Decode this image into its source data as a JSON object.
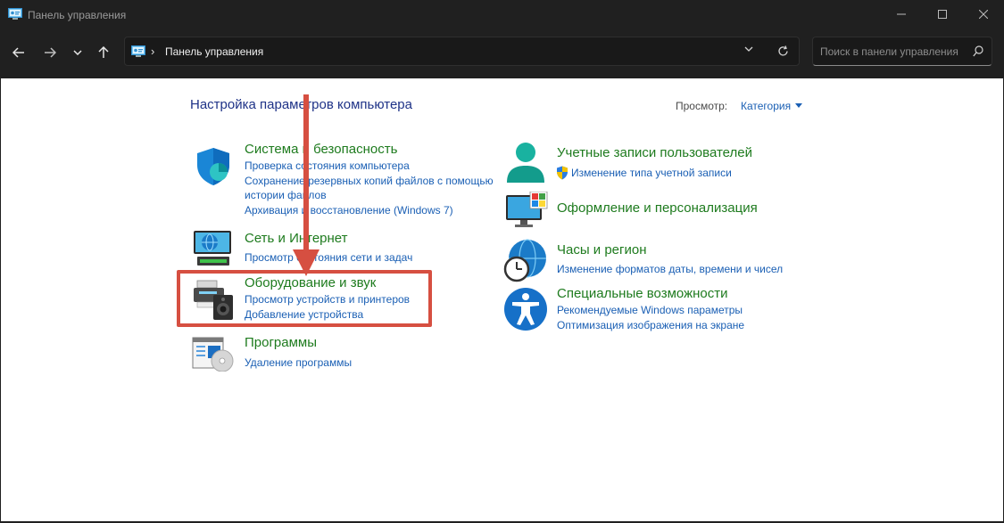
{
  "window": {
    "title": "Панель управления",
    "controls": [
      "minimize",
      "maximize",
      "close"
    ]
  },
  "nav": {
    "back_icon": "back-arrow-icon",
    "forward_icon": "forward-arrow-icon",
    "recent_icon": "chevron-down-icon",
    "up_icon": "up-arrow-icon"
  },
  "address": {
    "path": "Панель управления",
    "separator": "›"
  },
  "search": {
    "placeholder": "Поиск в панели управления"
  },
  "content": {
    "heading": "Настройка параметров компьютера",
    "view_label": "Просмотр:",
    "view_value": "Категория"
  },
  "categories_left": [
    {
      "title": "Система и безопасность",
      "icon": "shield-icon",
      "links": [
        "Проверка состояния компьютера",
        "Сохранение резервных копий файлов с помощью",
        "истории файлов",
        "Архивация и восстановление (Windows 7)"
      ]
    },
    {
      "title": "Сеть и Интернет",
      "icon": "network-globe-icon",
      "links": [
        "Просмотр состояния сети и задач"
      ]
    },
    {
      "title": "Оборудование и звук",
      "icon": "printer-speaker-icon",
      "links": [
        "Просмотр устройств и принтеров",
        "Добавление устройства"
      ]
    },
    {
      "title": "Программы",
      "icon": "programs-disc-icon",
      "links": [
        "Удаление программы"
      ]
    }
  ],
  "categories_right": [
    {
      "title": "Учетные записи пользователей",
      "icon": "user-account-icon",
      "links": [
        "Изменение типа учетной записи"
      ],
      "link_icon": "uac-shield-icon"
    },
    {
      "title": "Оформление и персонализация",
      "icon": "monitor-palette-icon",
      "links": []
    },
    {
      "title": "Часы и регион",
      "icon": "clock-globe-icon",
      "links": [
        "Изменение форматов даты, времени и чисел"
      ]
    },
    {
      "title": "Специальные возможности",
      "icon": "accessibility-icon",
      "links": [
        "Рекомендуемые Windows параметры",
        "Оптимизация изображения на экране"
      ]
    }
  ],
  "annotation": {
    "arrow_color": "#d64f41",
    "highlighted_category": "Оборудование и звук"
  }
}
